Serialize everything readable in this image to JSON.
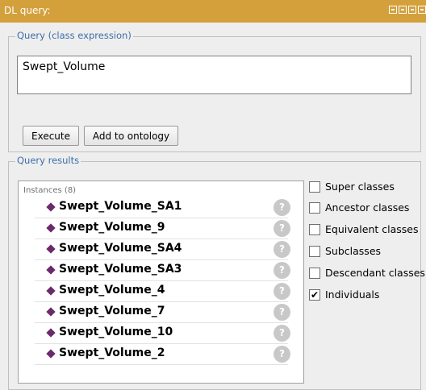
{
  "window": {
    "title": "DL query:",
    "controls": [
      "restore-icon",
      "minimize-icon",
      "maximize-icon",
      "close-icon"
    ]
  },
  "query": {
    "group_label": "Query (class expression)",
    "expression": "Swept_Volume",
    "execute_label": "Execute",
    "add_label": "Add to ontology"
  },
  "results": {
    "group_label": "Query results",
    "list_header": "Instances (8)",
    "items": [
      {
        "label": "Swept_Volume_SA1",
        "help": "?"
      },
      {
        "label": "Swept_Volume_9",
        "help": "?"
      },
      {
        "label": "Swept_Volume_SA4",
        "help": "?"
      },
      {
        "label": "Swept_Volume_SA3",
        "help": "?"
      },
      {
        "label": "Swept_Volume_4",
        "help": "?"
      },
      {
        "label": "Swept_Volume_7",
        "help": "?"
      },
      {
        "label": "Swept_Volume_10",
        "help": "?"
      },
      {
        "label": "Swept_Volume_2",
        "help": "?"
      }
    ]
  },
  "options": [
    {
      "label": "Super classes",
      "checked": false
    },
    {
      "label": "Ancestor classes",
      "checked": false
    },
    {
      "label": "Equivalent classes",
      "checked": false
    },
    {
      "label": "Subclasses",
      "checked": false
    },
    {
      "label": "Descendant classes",
      "checked": false
    },
    {
      "label": "Individuals",
      "checked": true
    }
  ],
  "colors": {
    "titlebar": "#d4a03c",
    "group_label": "#3b6ea8",
    "individual_icon": "#6b2a6b"
  }
}
